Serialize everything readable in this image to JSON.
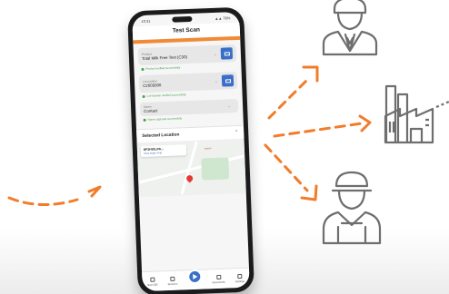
{
  "app": {
    "title": "Test Scan"
  },
  "status": {
    "time": "10:31",
    "signal": "▲▲ 76%"
  },
  "fields": [
    {
      "label": "Product",
      "value": "Total Milk Free Test (C30)",
      "status": "Product verified successfully",
      "has_button": true
    },
    {
      "label": "Lot number",
      "value": "C2005008",
      "status": "Lot Number verified successfully",
      "has_button": true
    },
    {
      "label": "Name",
      "value": "Contact",
      "status": "Name captured successfully",
      "has_button": false
    }
  ],
  "location": {
    "header": "Selected Location",
    "place_name": "8F3H9G,PA...",
    "place_link": "View larger map",
    "map_poi": "Lavoro"
  },
  "nav": {
    "scan_qr": "Scan QR",
    "services": "Services",
    "documents": "Documents",
    "settings": "Settings"
  },
  "colors": {
    "accent_orange": "#f08a35",
    "arrow_orange": "#f27c2a",
    "primary_blue": "#3a6fc7",
    "success_green": "#43a047",
    "icon_gray": "#6e6e6e"
  },
  "icons": [
    "business-person-icon",
    "factory-icon",
    "worker-icon"
  ]
}
